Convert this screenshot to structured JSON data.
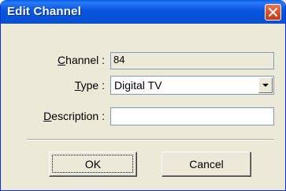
{
  "window": {
    "title": "Edit Channel"
  },
  "form": {
    "channel": {
      "label_accel": "C",
      "label_rest": "hannel :",
      "value": "84"
    },
    "type": {
      "label_accel": "T",
      "label_rest": "ype :",
      "selected": "Digital TV"
    },
    "description": {
      "label_accel": "D",
      "label_rest": "escription :",
      "value": ""
    }
  },
  "buttons": {
    "ok": "OK",
    "cancel": "Cancel"
  },
  "icons": {
    "close": "close-icon",
    "dropdown": "chevron-down-icon"
  },
  "colors": {
    "titlebar": "#0a58e0",
    "close_button": "#d9502c",
    "window_bg": "#ece9d8"
  }
}
